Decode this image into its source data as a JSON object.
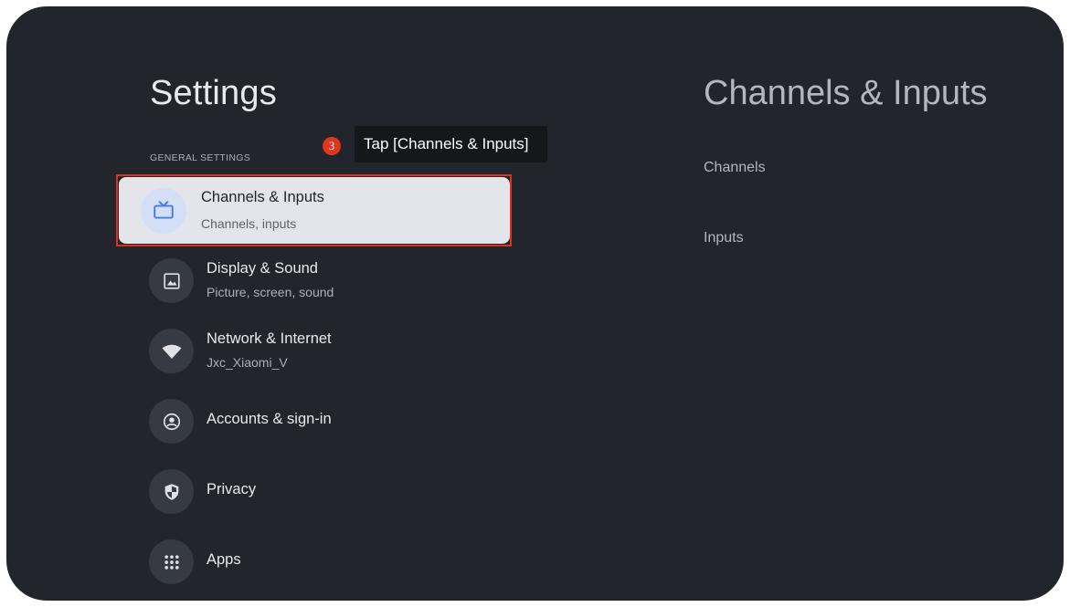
{
  "left_panel": {
    "title": "Settings",
    "section_label": "GENERAL SETTINGS",
    "items": [
      {
        "label": "Channels & Inputs",
        "sublabel": "Channels, inputs",
        "icon": "tv-icon",
        "selected": true
      },
      {
        "label": "Display & Sound",
        "sublabel": "Picture, screen, sound",
        "icon": "image-icon"
      },
      {
        "label": "Network & Internet",
        "sublabel": "Jxc_Xiaomi_V",
        "icon": "wifi-icon"
      },
      {
        "label": "Accounts & sign-in",
        "sublabel": "",
        "icon": "account-icon"
      },
      {
        "label": "Privacy",
        "sublabel": "",
        "icon": "shield-icon"
      },
      {
        "label": "Apps",
        "sublabel": "",
        "icon": "apps-grid-icon"
      }
    ]
  },
  "callout": {
    "step": "3",
    "text": "Tap [Channels & Inputs]"
  },
  "right_panel": {
    "title": "Channels & Inputs",
    "items": [
      {
        "label": "Channels"
      },
      {
        "label": "Inputs"
      }
    ]
  },
  "colors": {
    "background": "#22252c",
    "selected_bg": "#e4e5ea",
    "highlight": "#e0301e",
    "accent_blue": "#4c7be0"
  }
}
